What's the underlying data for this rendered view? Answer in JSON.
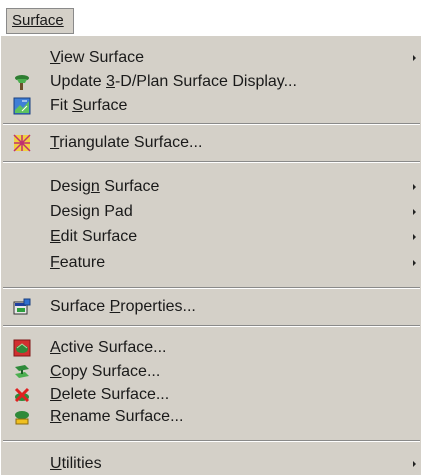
{
  "menubar": {
    "title": "Surface"
  },
  "menu": {
    "items": [
      {
        "pre": "",
        "key": "V",
        "post": "iew Surface",
        "icon": "none",
        "submenu": true
      },
      {
        "pre": "Update ",
        "key": "3",
        "post": "-D/Plan Surface Display...",
        "icon": "update-surface-icon",
        "submenu": false
      },
      {
        "pre": "Fit ",
        "key": "S",
        "post": "urface",
        "icon": "fit-surface-icon",
        "submenu": false
      },
      {
        "pre": "",
        "key": "T",
        "post": "riangulate Surface...",
        "icon": "triangulate-icon",
        "submenu": false
      },
      {
        "pre": "Desig",
        "key": "n",
        "post": " Surface",
        "icon": "none",
        "submenu": true
      },
      {
        "pre": "Design Pad",
        "key": "",
        "post": "",
        "icon": "none",
        "submenu": true
      },
      {
        "pre": "",
        "key": "E",
        "post": "dit Surface",
        "icon": "none",
        "submenu": true
      },
      {
        "pre": "",
        "key": "F",
        "post": "eature",
        "icon": "none",
        "submenu": true
      },
      {
        "pre": "Surface ",
        "key": "P",
        "post": "roperties...",
        "icon": "surface-properties-icon",
        "submenu": false
      },
      {
        "pre": "",
        "key": "A",
        "post": "ctive Surface...",
        "icon": "active-surface-icon",
        "submenu": false
      },
      {
        "pre": "",
        "key": "C",
        "post": "opy Surface...",
        "icon": "copy-surface-icon",
        "submenu": false
      },
      {
        "pre": "",
        "key": "D",
        "post": "elete Surface...",
        "icon": "delete-surface-icon",
        "submenu": false
      },
      {
        "pre": "",
        "key": "R",
        "post": "ename Surface...",
        "icon": "rename-surface-icon",
        "submenu": false
      },
      {
        "pre": "",
        "key": "U",
        "post": "tilities",
        "icon": "none",
        "submenu": true
      }
    ]
  }
}
